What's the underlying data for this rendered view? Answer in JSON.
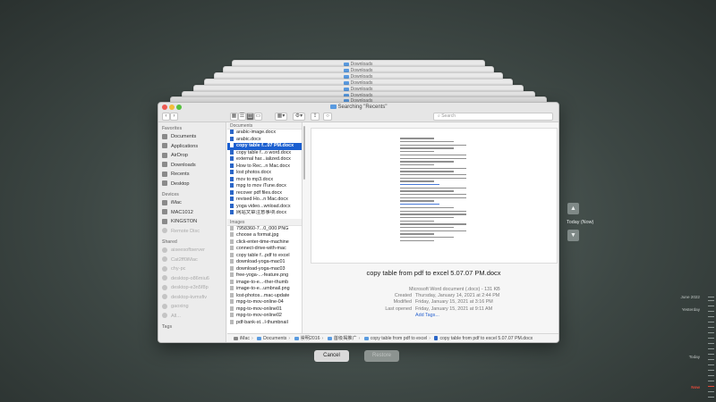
{
  "background_windows": [
    {
      "title": "Downloads"
    },
    {
      "title": "Downloads"
    },
    {
      "title": "Downloads"
    },
    {
      "title": "Downloads"
    },
    {
      "title": "Downloads"
    },
    {
      "title": "Downloads"
    },
    {
      "title": "Downloads"
    }
  ],
  "window": {
    "title": "Searching \"Recents\"",
    "search_placeholder": "Search"
  },
  "sidebar": {
    "favorites_header": "Favorites",
    "favorites": [
      "Documents",
      "Applications",
      "AirDrop",
      "Downloads",
      "Recents",
      "Desktop"
    ],
    "devices_header": "Devices",
    "devices": [
      "iMac",
      "MAC1012",
      "KINGSTON",
      "Remote Disc"
    ],
    "shared_header": "Shared",
    "shared": [
      "aiseesoftserver",
      "Cat2ff0iMac",
      "chy-pc",
      "desktop-o86miu6",
      "desktop-e3n5f8p",
      "desktop-kvmsfiv",
      "gaoxing",
      "All..."
    ],
    "tags_header": "Tags"
  },
  "files": {
    "documents_header": "Documents",
    "documents": [
      "arabic-image.docx",
      "arabic.docx",
      "copy table f...07 PM.docx",
      "copy table f...o word.docx",
      "external har...ialized.docx",
      "How to Rec...n Mac.docx",
      "lost photos.docx",
      "mov to mp3.docx",
      "mpg to mov iTune.docx",
      "recover pdf files.docx",
      "revised Ho...n Mac.docx",
      "yoga video...wnload.docx",
      "网站文章注意事项.docx"
    ],
    "selected_index": 2,
    "images_header": "Images",
    "images": [
      "7958360-7...0_000.PNG",
      "choose a format.jpg",
      "click-enter-time-machine",
      "connect-drive-with-mac",
      "copy table f...pdf to excel",
      "download-yoga-mac01",
      "download-yoga-mac03",
      "free-yoga-...-feature.png",
      "image-to-e...-ther-thumb",
      "image-to-e...umbnail.png",
      "lost-photos...mac-update",
      "mpg-to-mov-online-04",
      "mpg-to-mov-online01",
      "mpg-to-mov-online02",
      "pdf-bank-st...l-thumbnail"
    ]
  },
  "preview": {
    "filename": "copy table from pdf to excel 5.07.07 PM.docx",
    "kind": "Microsoft Word document (.docx) - 131 KB",
    "created_label": "Created",
    "created": "Thursday, January 14, 2021 at 2:44 PM",
    "modified_label": "Modified",
    "modified": "Friday, January 15, 2021 at 3:16 PM",
    "last_opened_label": "Last opened",
    "last_opened": "Friday, January 15, 2021 at 9:11 AM",
    "add_tags": "Add Tags..."
  },
  "pathbar": [
    "iMac",
    "Documents",
    "崇明2016",
    "首级揭推广",
    "copy table from pdf to excel",
    "copy table from pdf to excel 5.07.07 PM.docx"
  ],
  "buttons": {
    "cancel": "Cancel",
    "restore": "Restore"
  },
  "timemachine": {
    "up_arrow": "▲",
    "down_arrow": "▼",
    "today_now": "Today (Now)",
    "timeline": [
      "June 2022",
      "Yesterday",
      "Today",
      "Now"
    ]
  }
}
